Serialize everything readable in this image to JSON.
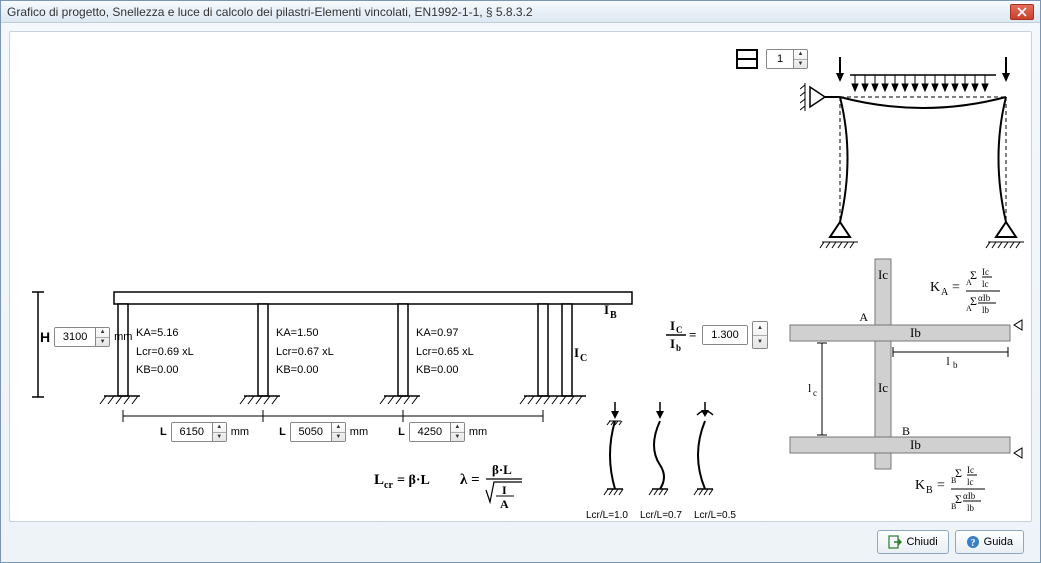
{
  "title": "Grafico di progetto, Snellezza e luce di calcolo dei pilastri-Elementi vincolati,  EN1992-1-1, § 5.8.3.2",
  "story_count": "1",
  "h_label": "H",
  "h_value": "3100",
  "h_unit": "mm",
  "L_letter": "L",
  "L_unit": "mm",
  "spans": [
    {
      "value": "6150"
    },
    {
      "value": "5050"
    },
    {
      "value": "4250"
    }
  ],
  "columns": [
    {
      "KA": "KA=5.16",
      "Lcr": "Lcr=0.69 xL",
      "KB": "KB=0.00"
    },
    {
      "KA": "KA=1.50",
      "Lcr": "Lcr=0.67 xL",
      "KB": "KB=0.00"
    },
    {
      "KA": "KA=0.97",
      "Lcr": "Lcr=0.65 xL",
      "KB": "KB=0.00"
    }
  ],
  "ratio_value": "1.300",
  "labels": {
    "Ic": "I",
    "Ib": "I",
    "IcOverIb_top": "I",
    "LcrEq": "L",
    "beta": "β",
    "lambda": "λ",
    "subC": "C",
    "subB": "B",
    "subCr": "cr",
    "KA": "K",
    "KB": "K",
    "subA": "A",
    "sigma": "Σ",
    "alpha": "α",
    "l": "l",
    "sub_c": "c",
    "sub_b": "b",
    "A_node": "A",
    "B_node": "B"
  },
  "buckling_labels": [
    "Lcr/L=1.0",
    "Lcr/L=0.7",
    "Lcr/L=0.5"
  ],
  "buttons": {
    "close": "Chiudi",
    "help": "Guida"
  }
}
